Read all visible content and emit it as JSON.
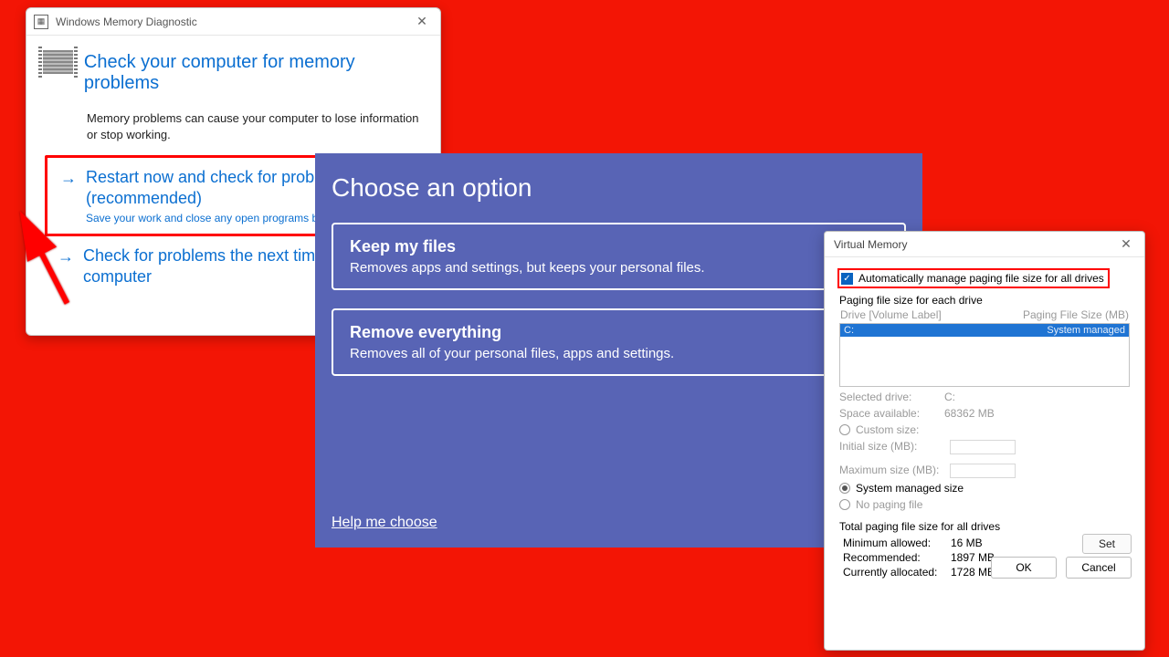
{
  "mdiag": {
    "window_title": "Windows Memory Diagnostic",
    "heading": "Check your computer for memory problems",
    "description": "Memory problems can cause your computer to lose information or stop working.",
    "opt1_label": "Restart now and check for problems (recommended)",
    "opt1_sub": "Save your work and close any open programs before restarting.",
    "opt2_label": "Check for problems the next time I start my computer"
  },
  "recovery": {
    "heading": "Choose an option",
    "keep_t": "Keep my files",
    "keep_d": "Removes apps and settings, but keeps your personal files.",
    "remove_t": "Remove everything",
    "remove_d": "Removes all of your personal files, apps and settings.",
    "help": "Help me choose"
  },
  "vm": {
    "title": "Virtual Memory",
    "auto_label": "Automatically manage paging file size for all drives",
    "section": "Paging file size for each drive",
    "col_drive": "Drive  [Volume Label]",
    "col_size": "Paging File Size (MB)",
    "row_drive": "C:",
    "row_val": "System managed",
    "sel_drive_k": "Selected drive:",
    "sel_drive_v": "C:",
    "space_k": "Space available:",
    "space_v": "68362 MB",
    "r_custom": "Custom size:",
    "init_k": "Initial size (MB):",
    "max_k": "Maximum size (MB):",
    "r_system": "System managed size",
    "r_none": "No paging file",
    "set": "Set",
    "total_h": "Total paging file size for all drives",
    "min_k": "Minimum allowed:",
    "min_v": "16 MB",
    "rec_k": "Recommended:",
    "rec_v": "1897 MB",
    "cur_k": "Currently allocated:",
    "cur_v": "1728 MB",
    "ok": "OK",
    "cancel": "Cancel"
  }
}
